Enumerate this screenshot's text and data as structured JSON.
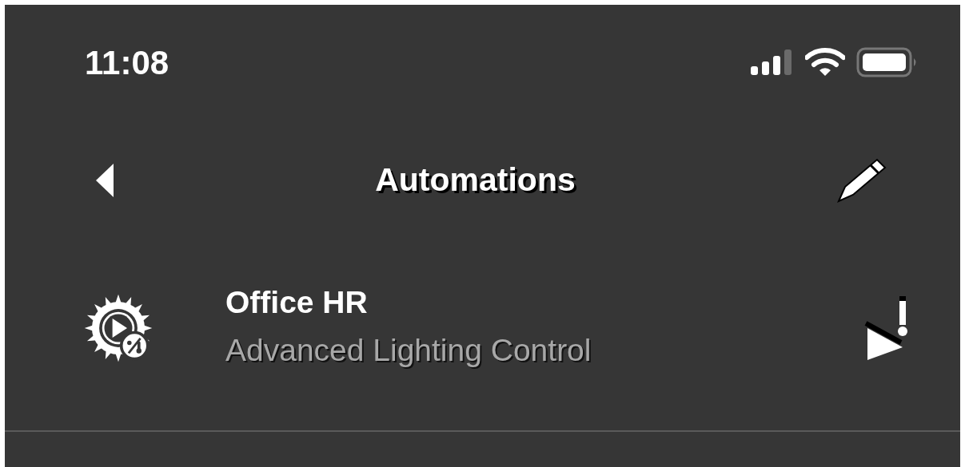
{
  "status_bar": {
    "time": "11:08"
  },
  "nav": {
    "title": "Automations"
  },
  "automations": [
    {
      "name": "Office HR",
      "subtitle": "Advanced Lighting Control"
    }
  ]
}
